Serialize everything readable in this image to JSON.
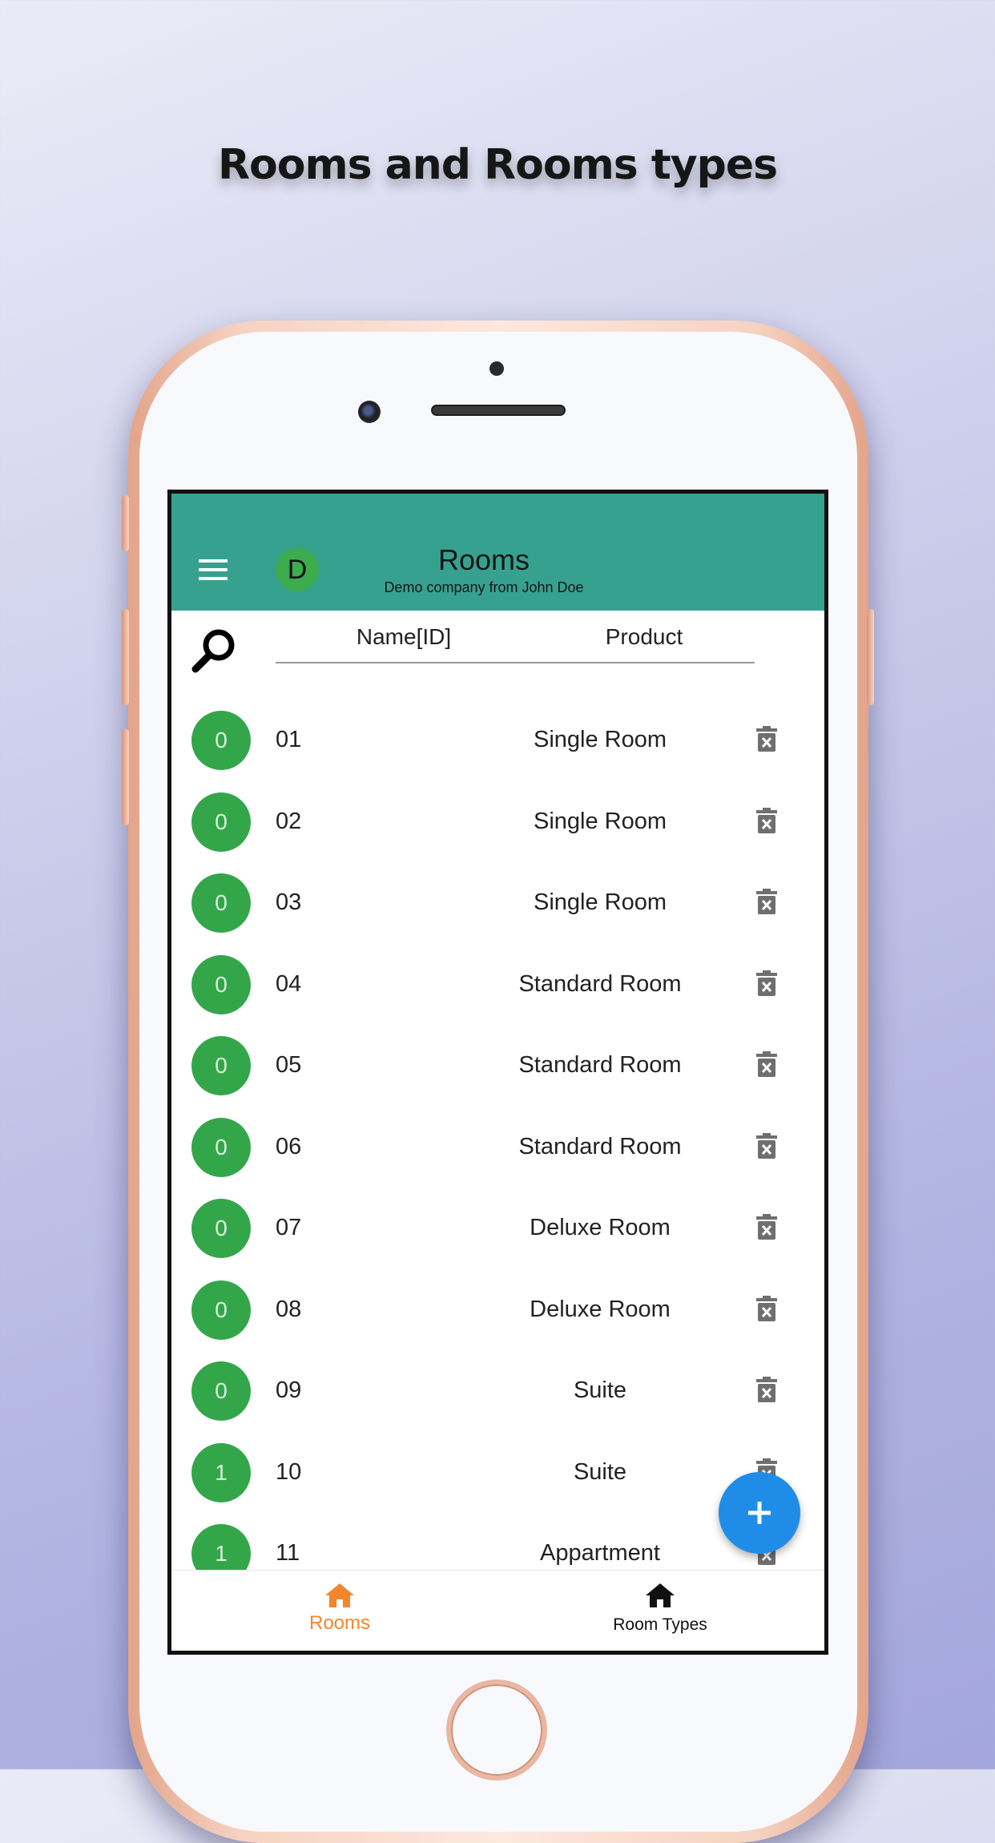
{
  "headline": "Rooms and Rooms types",
  "appbar": {
    "avatar_initial": "D",
    "title": "Rooms",
    "subtitle": "Demo company from John Doe",
    "color": "#37a190"
  },
  "table": {
    "headers": {
      "name": "Name[ID]",
      "product": "Product"
    },
    "rows": [
      {
        "count": "0",
        "name": "01",
        "product": "Single Room"
      },
      {
        "count": "0",
        "name": "02",
        "product": "Single Room"
      },
      {
        "count": "0",
        "name": "03",
        "product": "Single Room"
      },
      {
        "count": "0",
        "name": "04",
        "product": "Standard Room"
      },
      {
        "count": "0",
        "name": "05",
        "product": "Standard Room"
      },
      {
        "count": "0",
        "name": "06",
        "product": "Standard Room"
      },
      {
        "count": "0",
        "name": "07",
        "product": "Deluxe Room"
      },
      {
        "count": "0",
        "name": "08",
        "product": "Deluxe Room"
      },
      {
        "count": "0",
        "name": "09",
        "product": "Suite"
      },
      {
        "count": "1",
        "name": "10",
        "product": "Suite"
      },
      {
        "count": "1",
        "name": "11",
        "product": "Appartment"
      }
    ]
  },
  "fab": {
    "icon": "plus-icon",
    "color": "#1f8de8"
  },
  "bottom_nav": {
    "items": [
      {
        "label": "Rooms",
        "icon": "home-icon",
        "active": true,
        "color": "#f3862d"
      },
      {
        "label": "Room Types",
        "icon": "home-icon",
        "active": false,
        "color": "#111111"
      }
    ]
  }
}
